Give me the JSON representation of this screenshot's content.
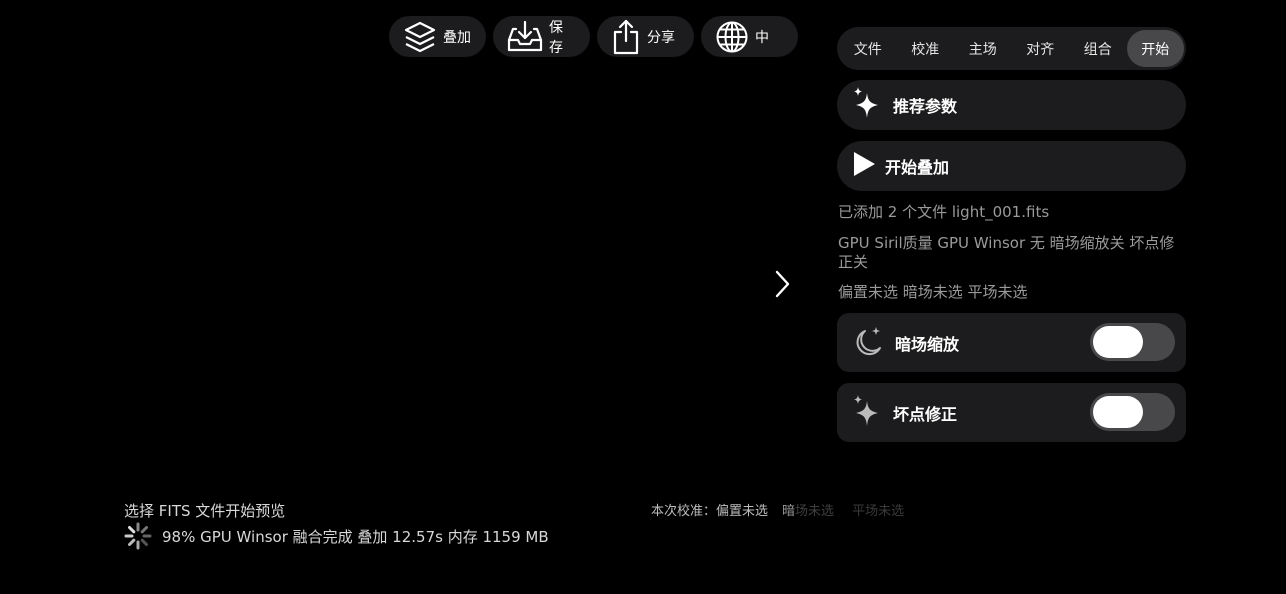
{
  "toolbar": {
    "stack_label": "叠加",
    "save_label": "保存",
    "share_label": "分享",
    "lang_label": "中"
  },
  "tabs": [
    {
      "label": "文件",
      "active": false
    },
    {
      "label": "校准",
      "active": false
    },
    {
      "label": "主场",
      "active": false
    },
    {
      "label": "对齐",
      "active": false
    },
    {
      "label": "组合",
      "active": false
    },
    {
      "label": "开始",
      "active": true
    }
  ],
  "actions": {
    "recommend_label": "推荐参数",
    "start_label": "开始叠加"
  },
  "info": {
    "files": "已添加 2 个文件  light_001.fits",
    "settings": "GPU Siril质量  GPU Winsor  无  暗场缩放关  坏点修正关",
    "calibration": "偏置未选  暗场未选  平场未选"
  },
  "toggles": {
    "dark_scale": {
      "label": "暗场缩放",
      "on": false
    },
    "bad_pixel": {
      "label": "坏点修正",
      "on": false
    }
  },
  "status": {
    "hint": "选择 FITS 文件开始预览",
    "progress": "98% GPU Winsor 融合完成  叠加 12.57s  内存 1159 MB",
    "calib_lead": "本次校准：",
    "calib_bias": "偏置未选",
    "calib_dark_a": "暗",
    "calib_dark_b": "场未选",
    "calib_flat": "平场未选"
  },
  "colors": {
    "background": "#000000",
    "surface": "#1c1c1e",
    "active_tab": "#48484a",
    "muted_text": "#9a9a9a"
  }
}
